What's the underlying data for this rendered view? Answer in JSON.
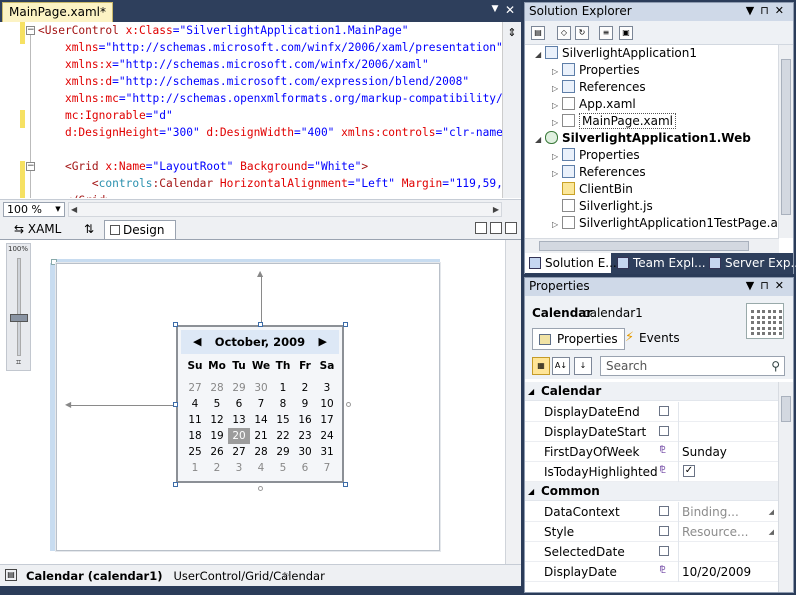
{
  "document_tab": {
    "label": "MainPage.xaml*"
  },
  "xaml": {
    "lines": [
      {
        "tag": "<UserControl ",
        "attr": "x:Class",
        "eq": "=",
        "val": "\"SilverlightApplication1.MainPage\""
      },
      {
        "attr": "xmlns:x",
        "eq": "=",
        "val": "\"http://schemas.microsoft.com/winfx/2006/xaml\""
      },
      {
        "attr": "xmlns:d",
        "eq": "=",
        "val": "\"http://schemas.microsoft.com/expression/blend/2008\""
      },
      {
        "attr": "xmlns:mc",
        "eq": "=",
        "val": "\"http://schemas.openxmlformats.org/markup-compatibility/20"
      },
      {
        "attr": "mc:Ignorable",
        "eq": "=",
        "val": "\"d\""
      },
      {
        "attr": "d:DesignHeight",
        "eq": "=",
        "val": "\"300\"",
        "attr2": " d:DesignWidth",
        "eq2": "=",
        "val2": "\"400\"",
        "attr3": " xmlns:controls",
        "eq3": "=",
        "val3": "\"clr-namesp"
      },
      {
        "tag": "<Grid ",
        "attr": "x:Name",
        "eq": "=",
        "val": "\"LayoutRoot\"",
        "attr2": " Background",
        "eq2": "=",
        "val2": "\"White\"",
        "close": ">"
      },
      {
        "tag": "<",
        "ns": "controls",
        "tag2": ":Calendar ",
        "attr": "HorizontalAlignment",
        "eq": "=",
        "val": "\"Left\"",
        "attr2": " Margin",
        "eq2": "=",
        "val2": "\"119,59,0,"
      },
      {
        "tag": "</Grid>"
      }
    ],
    "xmlns_line": {
      "attr": "xmlns",
      "eq": "=",
      "val": "\"http://schemas.microsoft.com/winfx/2006/xaml/presentation\""
    }
  },
  "zoom": {
    "value": "100 %"
  },
  "view_tabs": {
    "xaml": "XAML",
    "swap": "⇅",
    "design": "Design"
  },
  "zoom_slider": {
    "label": "100%"
  },
  "calendar": {
    "month": "October, 2009",
    "prev": "◀",
    "next": "▶",
    "days": [
      "Su",
      "Mo",
      "Tu",
      "We",
      "Th",
      "Fr",
      "Sa"
    ],
    "dates": [
      [
        "27",
        "28",
        "29",
        "30",
        "1",
        "2",
        "3"
      ],
      [
        "4",
        "5",
        "6",
        "7",
        "8",
        "9",
        "10"
      ],
      [
        "11",
        "12",
        "13",
        "14",
        "15",
        "16",
        "17"
      ],
      [
        "18",
        "19",
        "20",
        "21",
        "22",
        "23",
        "24"
      ],
      [
        "25",
        "26",
        "27",
        "28",
        "29",
        "30",
        "31"
      ],
      [
        "1",
        "2",
        "3",
        "4",
        "5",
        "6",
        "7"
      ]
    ],
    "today": "20"
  },
  "status": {
    "element": "Calendar (calendar1)",
    "path": "UserControl/Grid/Calendar"
  },
  "solution_explorer": {
    "title": "Solution Explorer",
    "tree": [
      {
        "label": "SilverlightApplication1",
        "level": 1,
        "icon": "project",
        "bold": false,
        "exp": "◢"
      },
      {
        "label": "Properties",
        "level": 2,
        "icon": "project",
        "exp": "▷"
      },
      {
        "label": "References",
        "level": 2,
        "icon": "project",
        "exp": "▷"
      },
      {
        "label": "App.xaml",
        "level": 2,
        "icon": "file",
        "exp": "▷"
      },
      {
        "label": "MainPage.xaml",
        "level": 2,
        "icon": "file",
        "exp": "▷",
        "selected": true
      },
      {
        "label": "SilverlightApplication1.Web",
        "level": 1,
        "icon": "web",
        "bold": true,
        "exp": "◢"
      },
      {
        "label": "Properties",
        "level": 2,
        "icon": "project",
        "exp": "▷"
      },
      {
        "label": "References",
        "level": 2,
        "icon": "project",
        "exp": "▷"
      },
      {
        "label": "ClientBin",
        "level": 2,
        "icon": "folder",
        "exp": ""
      },
      {
        "label": "Silverlight.js",
        "level": 2,
        "icon": "file",
        "exp": ""
      },
      {
        "label": "SilverlightApplication1TestPage.aspx",
        "level": 2,
        "icon": "file",
        "exp": "▷"
      }
    ],
    "tabs": [
      "Solution E...",
      "Team Expl...",
      "Server Exp..."
    ]
  },
  "properties": {
    "title": "Properties",
    "type": "Calendar",
    "name": "calendar1",
    "tab_properties": "Properties",
    "tab_events": "Events",
    "search_placeholder": "Search",
    "categories": [
      {
        "name": "Calendar",
        "rows": [
          {
            "name": "DisplayDateEnd",
            "marker": "box",
            "value": ""
          },
          {
            "name": "DisplayDateStart",
            "marker": "box",
            "value": ""
          },
          {
            "name": "FirstDayOfWeek",
            "marker": "evt",
            "value": "Sunday"
          },
          {
            "name": "IsTodayHighlighted",
            "marker": "evt",
            "value": "",
            "check": "✓"
          }
        ]
      },
      {
        "name": "Common",
        "rows": [
          {
            "name": "DataContext",
            "marker": "box",
            "value": "Binding...",
            "ghost": true,
            "ddl": "◢"
          },
          {
            "name": "Style",
            "marker": "box",
            "value": "Resource...",
            "ghost": true,
            "ddl": "◢"
          },
          {
            "name": "SelectedDate",
            "marker": "box",
            "value": ""
          },
          {
            "name": "DisplayDate",
            "marker": "evt",
            "value": "10/20/2009"
          }
        ]
      }
    ]
  }
}
